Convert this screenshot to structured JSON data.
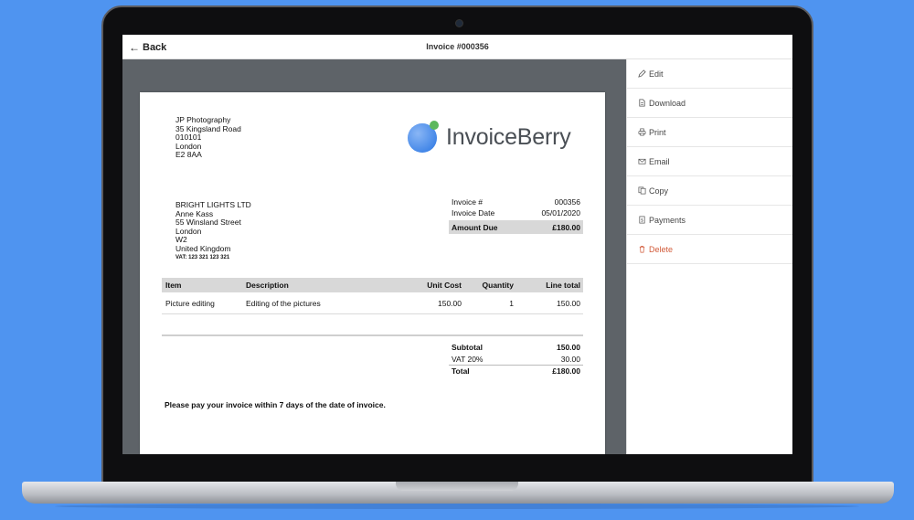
{
  "header": {
    "back_label": "Back",
    "title": "Invoice #000356"
  },
  "sidebar": {
    "items": [
      {
        "label": "Edit",
        "icon": "pencil-icon"
      },
      {
        "label": "Download",
        "icon": "document-icon"
      },
      {
        "label": "Print",
        "icon": "printer-icon"
      },
      {
        "label": "Email",
        "icon": "envelope-icon"
      },
      {
        "label": "Copy",
        "icon": "copy-icon"
      },
      {
        "label": "Payments",
        "icon": "dollar-document-icon"
      },
      {
        "label": "Delete",
        "icon": "trash-icon"
      }
    ]
  },
  "invoice": {
    "sender": [
      "JP Photography",
      "35 Kingsland Road",
      "010101",
      "London",
      "E2 8AA"
    ],
    "logo_text": "InvoiceBerry",
    "client": [
      "BRIGHT LIGHTS LTD",
      "Anne Kass",
      "55 Winsland Street",
      "London",
      "W2",
      "United Kingdom"
    ],
    "client_vat": "VAT: 123 321 123 321",
    "meta": {
      "number_label": "Invoice #",
      "number_value": "000356",
      "date_label": "Invoice Date",
      "date_value": "05/01/2020",
      "due_label": "Amount Due",
      "due_value": "£180.00"
    },
    "columns": {
      "item": "Item",
      "description": "Description",
      "unit_cost": "Unit Cost",
      "quantity": "Quantity",
      "line_total": "Line total"
    },
    "lines": [
      {
        "item": "Picture editing",
        "description": "Editing of the pictures",
        "unit_cost": "150.00",
        "quantity": "1",
        "line_total": "150.00"
      }
    ],
    "totals": {
      "subtotal_label": "Subtotal",
      "subtotal_value": "150.00",
      "vat_label": "VAT 20%",
      "vat_value": "30.00",
      "total_label": "Total",
      "total_value": "£180.00"
    },
    "note": "Please pay your invoice within 7 days of the date of invoice."
  },
  "colors": {
    "background": "#4f94f0",
    "logo_blue": "#4a8ff0",
    "logo_green": "#5cb85c",
    "delete_red": "#d25b3a"
  }
}
